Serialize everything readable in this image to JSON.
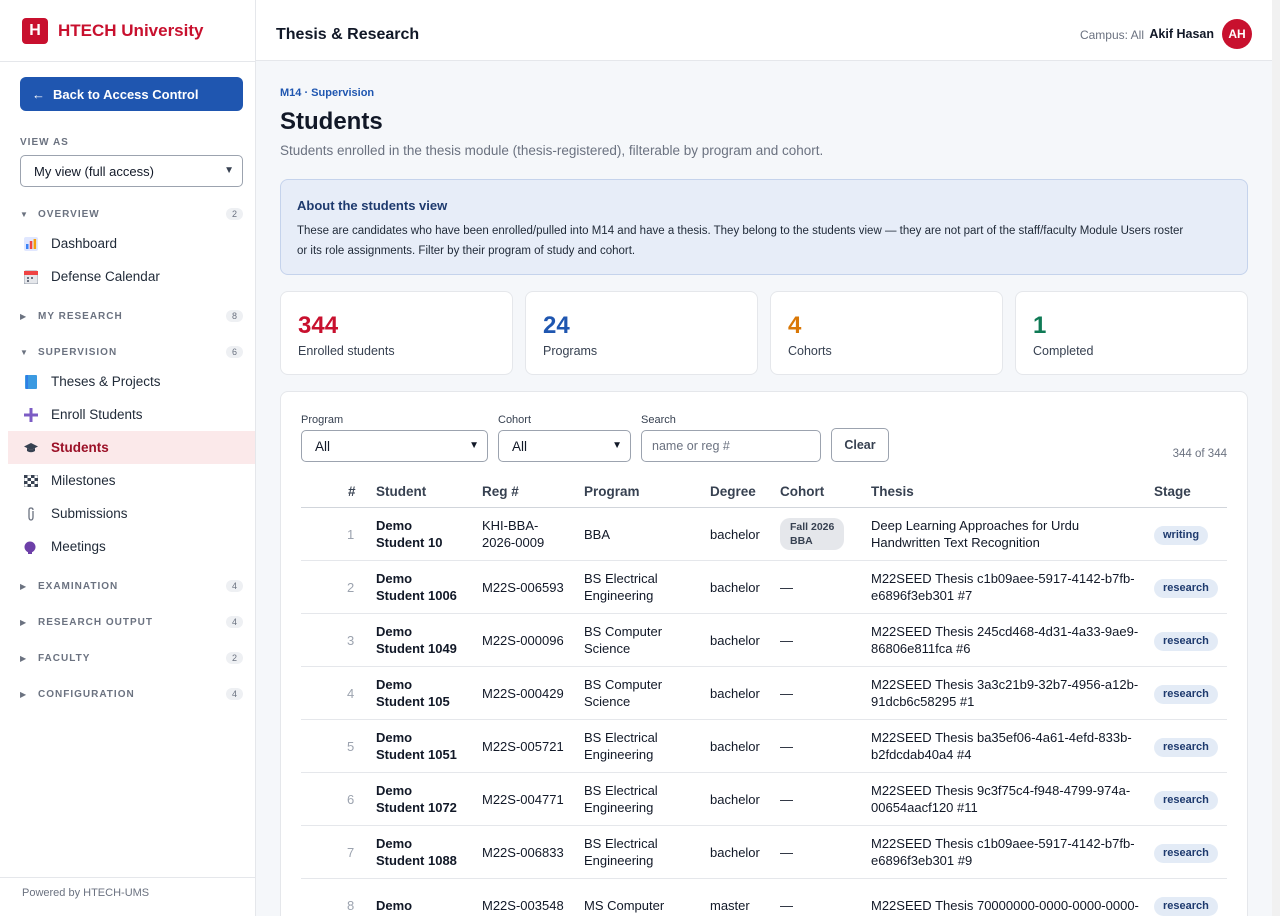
{
  "brand": {
    "logo_letter": "H",
    "name": "HTECH University"
  },
  "sidebar": {
    "back_label": "Back to Access Control",
    "back_arrow": "←",
    "view_as_label": "VIEW AS",
    "view_as_value": "My view (full access)",
    "overview": {
      "label": "OVERVIEW",
      "count": "2"
    },
    "dashboard": "Dashboard",
    "defense_calendar": "Defense Calendar",
    "my_research": {
      "label": "MY RESEARCH",
      "count": "8"
    },
    "supervision": {
      "label": "SUPERVISION",
      "count": "6"
    },
    "theses_projects": "Theses & Projects",
    "enroll_students": "Enroll Students",
    "students": "Students",
    "milestones": "Milestones",
    "submissions": "Submissions",
    "meetings": "Meetings",
    "examination": {
      "label": "EXAMINATION",
      "count": "4"
    },
    "research_output": {
      "label": "RESEARCH OUTPUT",
      "count": "4"
    },
    "faculty": {
      "label": "FACULTY",
      "count": "2"
    },
    "configuration": {
      "label": "CONFIGURATION",
      "count": "4"
    },
    "powered_by": "Powered by HTECH-UMS"
  },
  "header": {
    "title": "Thesis & Research",
    "campus": "Campus: All",
    "user_name": "Akif Hasan",
    "user_initials": "AH"
  },
  "page": {
    "eyebrow": "M14 · Supervision",
    "title": "Students",
    "subtitle": "Students enrolled in the thesis module (thesis-registered), filterable by program and cohort."
  },
  "info": {
    "title": "About the students view",
    "line1": "These are candidates who have been enrolled/pulled into M14 and have a thesis. They belong to the students view — they are not part of the staff/faculty Module Users roster",
    "line2": "or its role assignments. Filter by their program of study and cohort."
  },
  "stats": [
    {
      "value": "344",
      "label": "Enrolled students",
      "color": "#c8102e"
    },
    {
      "value": "24",
      "label": "Programs",
      "color": "#1f56b0"
    },
    {
      "value": "4",
      "label": "Cohorts",
      "color": "#d97706"
    },
    {
      "value": "1",
      "label": "Completed",
      "color": "#0f7a55"
    }
  ],
  "filters": {
    "program_label": "Program",
    "program_value": "All",
    "cohort_label": "Cohort",
    "cohort_value": "All",
    "search_label": "Search",
    "search_placeholder": "name or reg #",
    "clear_label": "Clear",
    "count_text": "344 of 344"
  },
  "table": {
    "columns": [
      "#",
      "Student",
      "Reg #",
      "Program",
      "Degree",
      "Cohort",
      "Thesis",
      "Stage"
    ],
    "rows": [
      {
        "num": "1",
        "student_1": "Demo",
        "student_2": "Student 10",
        "reg_1": "KHI-BBA-",
        "reg_2": "2026-0009",
        "program_1": "BBA",
        "program_2": "",
        "degree": "bachelor",
        "cohort_1": "Fall 2026",
        "cohort_2": "BBA",
        "thesis_1": "Deep Learning Approaches for Urdu",
        "thesis_2": "Handwritten Text Recognition",
        "stage": "writing"
      },
      {
        "num": "2",
        "student_1": "Demo",
        "student_2": "Student 1006",
        "reg_1": "M22S-006593",
        "reg_2": "",
        "program_1": "BS Electrical",
        "program_2": "Engineering",
        "degree": "bachelor",
        "cohort_1": "—",
        "cohort_2": "",
        "thesis_1": "M22SEED Thesis c1b09aee-5917-4142-b7fb-",
        "thesis_2": "e6896f3eb301 #7",
        "stage": "research"
      },
      {
        "num": "3",
        "student_1": "Demo",
        "student_2": "Student 1049",
        "reg_1": "M22S-000096",
        "reg_2": "",
        "program_1": "BS Computer",
        "program_2": "Science",
        "degree": "bachelor",
        "cohort_1": "—",
        "cohort_2": "",
        "thesis_1": "M22SEED Thesis 245cd468-4d31-4a33-9ae9-",
        "thesis_2": "86806e811fca #6",
        "stage": "research"
      },
      {
        "num": "4",
        "student_1": "Demo",
        "student_2": "Student 105",
        "reg_1": "M22S-000429",
        "reg_2": "",
        "program_1": "BS Computer",
        "program_2": "Science",
        "degree": "bachelor",
        "cohort_1": "—",
        "cohort_2": "",
        "thesis_1": "M22SEED Thesis 3a3c21b9-32b7-4956-a12b-",
        "thesis_2": "91dcb6c58295 #1",
        "stage": "research"
      },
      {
        "num": "5",
        "student_1": "Demo",
        "student_2": "Student 1051",
        "reg_1": "M22S-005721",
        "reg_2": "",
        "program_1": "BS Electrical",
        "program_2": "Engineering",
        "degree": "bachelor",
        "cohort_1": "—",
        "cohort_2": "",
        "thesis_1": "M22SEED Thesis ba35ef06-4a61-4efd-833b-",
        "thesis_2": "b2fdcdab40a4 #4",
        "stage": "research"
      },
      {
        "num": "6",
        "student_1": "Demo",
        "student_2": "Student 1072",
        "reg_1": "M22S-004771",
        "reg_2": "",
        "program_1": "BS Electrical",
        "program_2": "Engineering",
        "degree": "bachelor",
        "cohort_1": "—",
        "cohort_2": "",
        "thesis_1": "M22SEED Thesis 9c3f75c4-f948-4799-974a-",
        "thesis_2": "00654aacf120 #11",
        "stage": "research"
      },
      {
        "num": "7",
        "student_1": "Demo",
        "student_2": "Student 1088",
        "reg_1": "M22S-006833",
        "reg_2": "",
        "program_1": "BS Electrical",
        "program_2": "Engineering",
        "degree": "bachelor",
        "cohort_1": "—",
        "cohort_2": "",
        "thesis_1": "M22SEED Thesis c1b09aee-5917-4142-b7fb-",
        "thesis_2": "e6896f3eb301 #9",
        "stage": "research"
      },
      {
        "num": "8",
        "student_1": "Demo",
        "student_2": "",
        "reg_1": "M22S-003548",
        "reg_2": "",
        "program_1": "MS Computer",
        "program_2": "",
        "degree": "master",
        "cohort_1": "—",
        "cohort_2": "",
        "thesis_1": "M22SEED Thesis 70000000-0000-0000-0000-",
        "thesis_2": "",
        "stage": "research"
      }
    ]
  }
}
